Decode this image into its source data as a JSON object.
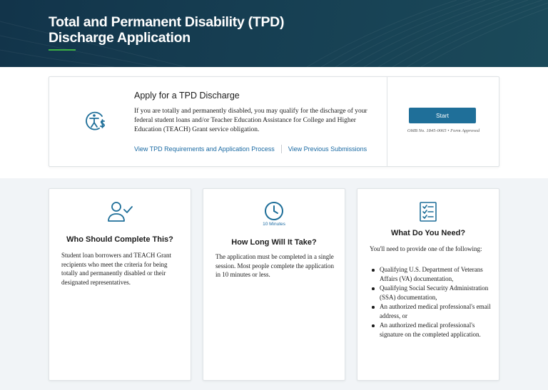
{
  "header": {
    "title": "Total and Permanent Disability (TPD) Discharge Application"
  },
  "apply": {
    "icon": "accessibility-dollar-icon",
    "heading": "Apply for a TPD Discharge",
    "description": "If you are totally and permanently disabled, you may qualify for the discharge of your federal student loans and/or Teacher Education Assistance for College and Higher Education (TEACH) Grant service obligation.",
    "link_requirements": "View TPD Requirements and Application Process",
    "link_previous": "View Previous Submissions",
    "start_label": "Start",
    "omb_note": "OMB No. 1845-0065 • Form Approved"
  },
  "cards": {
    "who": {
      "icon": "person-check-icon",
      "title": "Who Should Complete This?",
      "text": "Student loan borrowers and TEACH Grant recipients who meet the criteria for being totally and permanently disabled or their designated representatives."
    },
    "how_long": {
      "icon": "clock-icon",
      "sublabel": "10 Minutes",
      "title": "How Long Will It Take?",
      "text": "The application must be completed in a single session. Most people complete the application in 10 minutes or less."
    },
    "need": {
      "icon": "checklist-icon",
      "title": "What Do You Need?",
      "intro": "You'll need to provide one of the following:",
      "items": [
        "Qualifying U.S. Department of Veterans Affairs (VA) documentation,",
        "Qualifying Social Security Administration (SSA) documentation,",
        "An authorized medical professional's email address, or",
        "An authorized medical professional's signature on the completed application."
      ]
    }
  },
  "colors": {
    "accent": "#1a6aa3",
    "button": "#1f6f99",
    "header_bg": "#12344a",
    "underline": "#3cb043"
  }
}
